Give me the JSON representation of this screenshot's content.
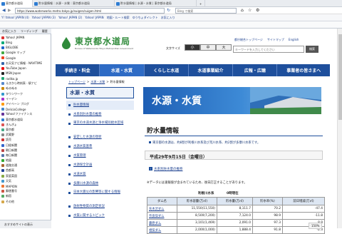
{
  "browser": {
    "tabs": [
      "東京都水道局",
      "貯水量情報｜水源・水質｜東京都水道局",
      "貯水量情報 | 水源・水質 | 東京都水道局"
    ],
    "toolbar": {
      "address_url": "https://www.waterworks.metro.tokyo.jp/suigen/suigen.html",
      "search_placeholder": "Bing で検索",
      "zoom": "150%"
    },
    "bookmarks": [
      "Y! Yahoo! JAPAN (4)",
      "Yahoo! JAPAN (3)",
      "Yahoo! JAPAN (2)",
      "Yahoo! JAPAN",
      "地図・ルート検索",
      "ゆうちょダイレクト",
      "お気に入り"
    ],
    "sidebar": {
      "tabs": [
        "お気に入り",
        "リーディング",
        "履歴"
      ],
      "items": [
        "Yahoo! JAPAN",
        "Bing",
        "BIGLOBE",
        "Google マップ",
        "Google",
        "お天気ナビ情報 - NAVITIME",
        "YouTube Japan",
        "MSN Japan",
        "radiko.jp",
        "えきから時刻表 - 駅ナビ",
        "ぬるぬる",
        "タウンワーク",
        "イーデン",
        "アイベーン ブログ",
        "DeliciaCollege",
        "Yahoo!ファイナンス",
        "東京都水道局",
        "きんぎょ",
        "東京都",
        "武蔵野",
        "読売",
        "日経新聞",
        "朝日新聞",
        "毎日新聞",
        "地図",
        "道路交通",
        "首都高",
        "家庭菜園",
        "天気",
        "MAPION",
        "郵便番号",
        "新宿",
        "その他"
      ],
      "footer": "おすすめサイトの表示"
    }
  },
  "site": {
    "header": {
      "logo": "東京都水道局",
      "logo_sub": "Bureau of Waterworks Tokyo Metropolitan Government",
      "font_size_label": "文字サイズ",
      "font_sizes": [
        "小",
        "中",
        "大"
      ],
      "links": [
        "都庁総合トップページ",
        "サイトマップ",
        "English"
      ],
      "search_placeholder": "キーワードを入力してください",
      "search_button": "検索"
    },
    "nav": [
      "手続き・料金",
      "水道・水質",
      "くらしと水道",
      "水道事業紹介",
      "広報・広聴",
      "事業者の皆さまへ"
    ],
    "breadcrumb": [
      "トップページ",
      "水源・水質",
      "貯水量情報"
    ],
    "leftnav": {
      "title": "水源・水質",
      "items": [
        "貯水量情報",
        "水系別貯水量の推移",
        "東京の水道水源と浄水場別給水区域",
        "安定した水源の現状",
        "水源水質基準",
        "水質管理",
        "水源保全計画",
        "水道水質",
        "多摩川水源の森林",
        "日本大震災の影響等に関する情報",
        "放射性物質の測定状況",
        "水質に関するトピック"
      ]
    },
    "main": {
      "title": "水源・水質",
      "page_title": "貯水量情報",
      "note": "東京都の水源は、約8割が利根川水系及び荒川水系、約2割が多摩川水系です。",
      "date": "平成29年9月15日（金曜日）",
      "link": "水系別貯水量の推移",
      "table_note": "※データには速報値が含まれているため、後日訂正することがあります。",
      "table_group": "利根川水系",
      "table_time": "0時現在",
      "table_headers": [
        "ダム名",
        "貯水容量(万㎥)",
        "貯水量(万㎥)",
        "貯水率(%)",
        "前日増減(万㎥)"
      ],
      "rows": [
        [
          "矢木沢ダム",
          "11,550(11,550)",
          "8,111.7",
          "70.2",
          "-47.4"
        ],
        [
          "奈良俣ダム",
          "8,500(7,200)",
          "7,124.0",
          "98.9",
          "-11.8"
        ],
        [
          "藤原ダム",
          "3,101(1,469)",
          "2,091.0",
          "97.3",
          "8.8"
        ],
        [
          "相俣ダム",
          "2,000(1,000)",
          "1,888.4",
          "91.8",
          "-2.3"
        ]
      ]
    }
  }
}
